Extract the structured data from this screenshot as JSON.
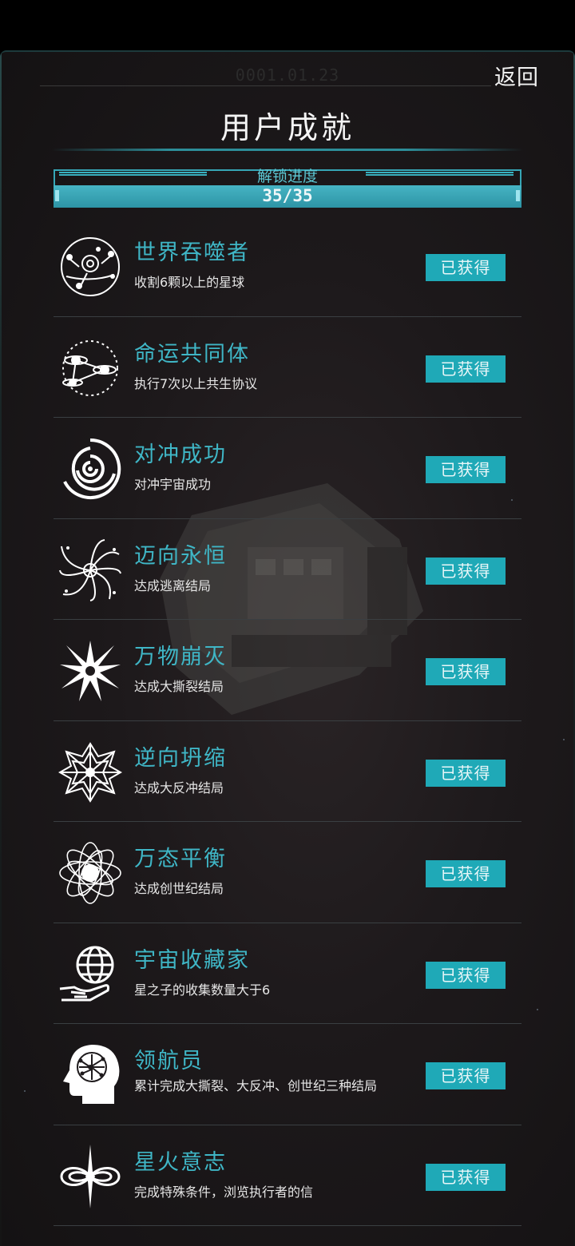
{
  "header": {
    "timestamp": "0001.01.23",
    "back_label": "返回",
    "title": "用户成就"
  },
  "progress": {
    "label": "解锁进度",
    "text": "35/35",
    "fraction": 1.0
  },
  "achievements": [
    {
      "title": "世界吞噬者",
      "desc": "收割6颗以上的星球",
      "status": "已获得",
      "icon": "planet-orbit-icon"
    },
    {
      "title": "命运共同体",
      "desc": "执行7次以上共生协议",
      "status": "已获得",
      "icon": "linked-planets-icon"
    },
    {
      "title": "对冲成功",
      "desc": "对冲宇宙成功",
      "status": "已获得",
      "icon": "spiral-vortex-icon"
    },
    {
      "title": "迈向永恒",
      "desc": "达成逃离结局",
      "status": "已获得",
      "icon": "swirl-escape-icon"
    },
    {
      "title": "万物崩灭",
      "desc": "达成大撕裂结局",
      "status": "已获得",
      "icon": "burst-icon"
    },
    {
      "title": "逆向坍缩",
      "desc": "达成大反冲结局",
      "status": "已获得",
      "icon": "mandala-icon"
    },
    {
      "title": "万态平衡",
      "desc": "达成创世纪结局",
      "status": "已获得",
      "icon": "atom-orbit-icon"
    },
    {
      "title": "宇宙收藏家",
      "desc": "星之子的收集数量大于6",
      "status": "已获得",
      "icon": "globe-hand-icon"
    },
    {
      "title": "领航员",
      "desc": "累计完成大撕裂、大反冲、创世纪三种结局",
      "status": "已获得",
      "icon": "brain-head-icon"
    },
    {
      "title": "星火意志",
      "desc": "完成特殊条件，浏览执行者的信",
      "status": "已获得",
      "icon": "infinity-star-icon"
    }
  ]
}
